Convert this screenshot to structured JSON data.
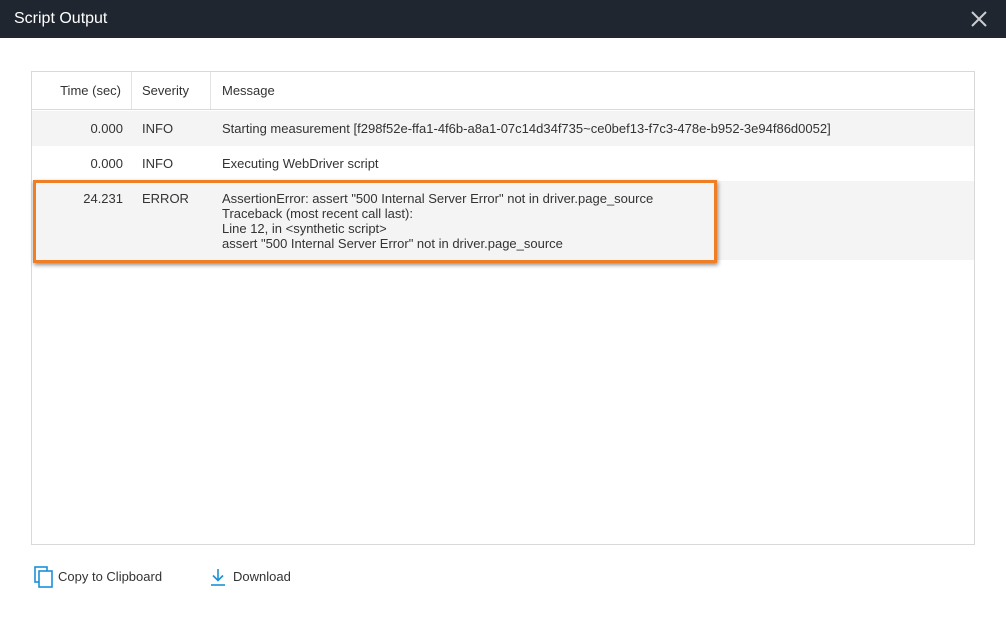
{
  "dialog": {
    "title": "Script Output",
    "close_icon": "close-icon"
  },
  "table": {
    "headers": {
      "time": "Time (sec)",
      "severity": "Severity",
      "message": "Message"
    },
    "rows": [
      {
        "time": "0.000",
        "severity": "INFO",
        "message": "Starting measurement [f298f52e-ffa1-4f6b-a8a1-07c14d34f735~ce0bef13-f7c3-478e-b952-3e94f86d0052]"
      },
      {
        "time": "0.000",
        "severity": "INFO",
        "message": "Executing WebDriver script"
      },
      {
        "time": "24.231",
        "severity": "ERROR",
        "message": "AssertionError: assert \"500 Internal Server Error\" not in driver.page_source\nTraceback (most recent call last):\nLine 12, in <synthetic script>\nassert \"500 Internal Server Error\" not in driver.page_source"
      }
    ]
  },
  "actions": {
    "copy_label": "Copy to Clipboard",
    "copy_icon": "copy-icon",
    "download_label": "Download",
    "download_icon": "download-icon"
  },
  "colors": {
    "titlebar": "#1f2630",
    "highlight": "#f07e24",
    "icon_blue": "#1a8fd8"
  }
}
